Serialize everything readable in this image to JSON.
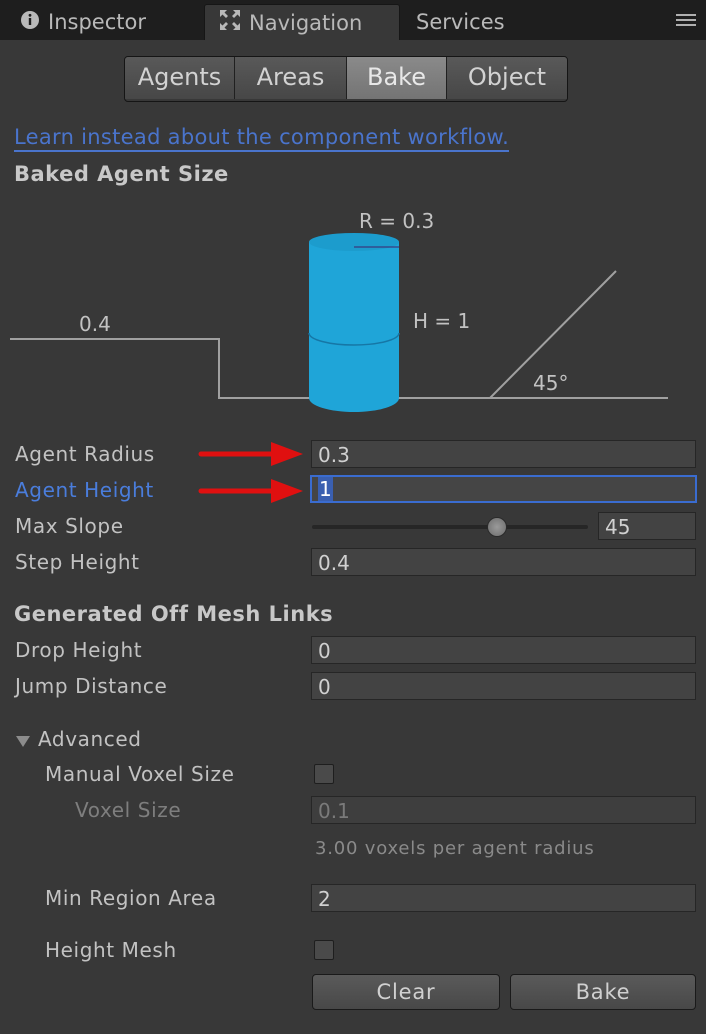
{
  "window_tabs": [
    {
      "label": "Inspector",
      "icon": "info-icon",
      "active": false
    },
    {
      "label": "Navigation",
      "icon": "navigation-icon",
      "active": true
    },
    {
      "label": "Services",
      "icon": "",
      "active": false
    }
  ],
  "toolbar": {
    "items": [
      "Agents",
      "Areas",
      "Bake",
      "Object"
    ],
    "selected": "Bake"
  },
  "component_link": "Learn instead about the component workflow.",
  "baked_agent_size": {
    "header": "Baked Agent Size",
    "diagram": {
      "radius_label": "R = 0.3",
      "height_label": "H = 1",
      "step_label": "0.4",
      "slope_label": "45°"
    }
  },
  "fields": {
    "agent_radius": {
      "label": "Agent Radius",
      "value": "0.3"
    },
    "agent_height": {
      "label": "Agent Height",
      "value": "1"
    },
    "max_slope": {
      "label": "Max Slope",
      "value": "45",
      "slider_fraction": 0.67
    },
    "step_height": {
      "label": "Step Height",
      "value": "0.4"
    }
  },
  "off_mesh": {
    "header": "Generated Off Mesh Links",
    "drop_height": {
      "label": "Drop Height",
      "value": "0"
    },
    "jump_distance": {
      "label": "Jump Distance",
      "value": "0"
    }
  },
  "advanced": {
    "label": "Advanced",
    "manual_voxel_size": {
      "label": "Manual Voxel Size",
      "checked": false
    },
    "voxel_size": {
      "label": "Voxel Size",
      "value": "0.1"
    },
    "voxel_note": "3.00 voxels per agent radius",
    "min_region_area": {
      "label": "Min Region Area",
      "value": "2"
    },
    "height_mesh": {
      "label": "Height Mesh",
      "checked": false
    }
  },
  "buttons": {
    "clear": "Clear",
    "bake": "Bake"
  },
  "colors": {
    "accent": "#4a7ddc",
    "agent_cylinder": "#1fa5d8",
    "annotation_arrow": "#e01010"
  }
}
